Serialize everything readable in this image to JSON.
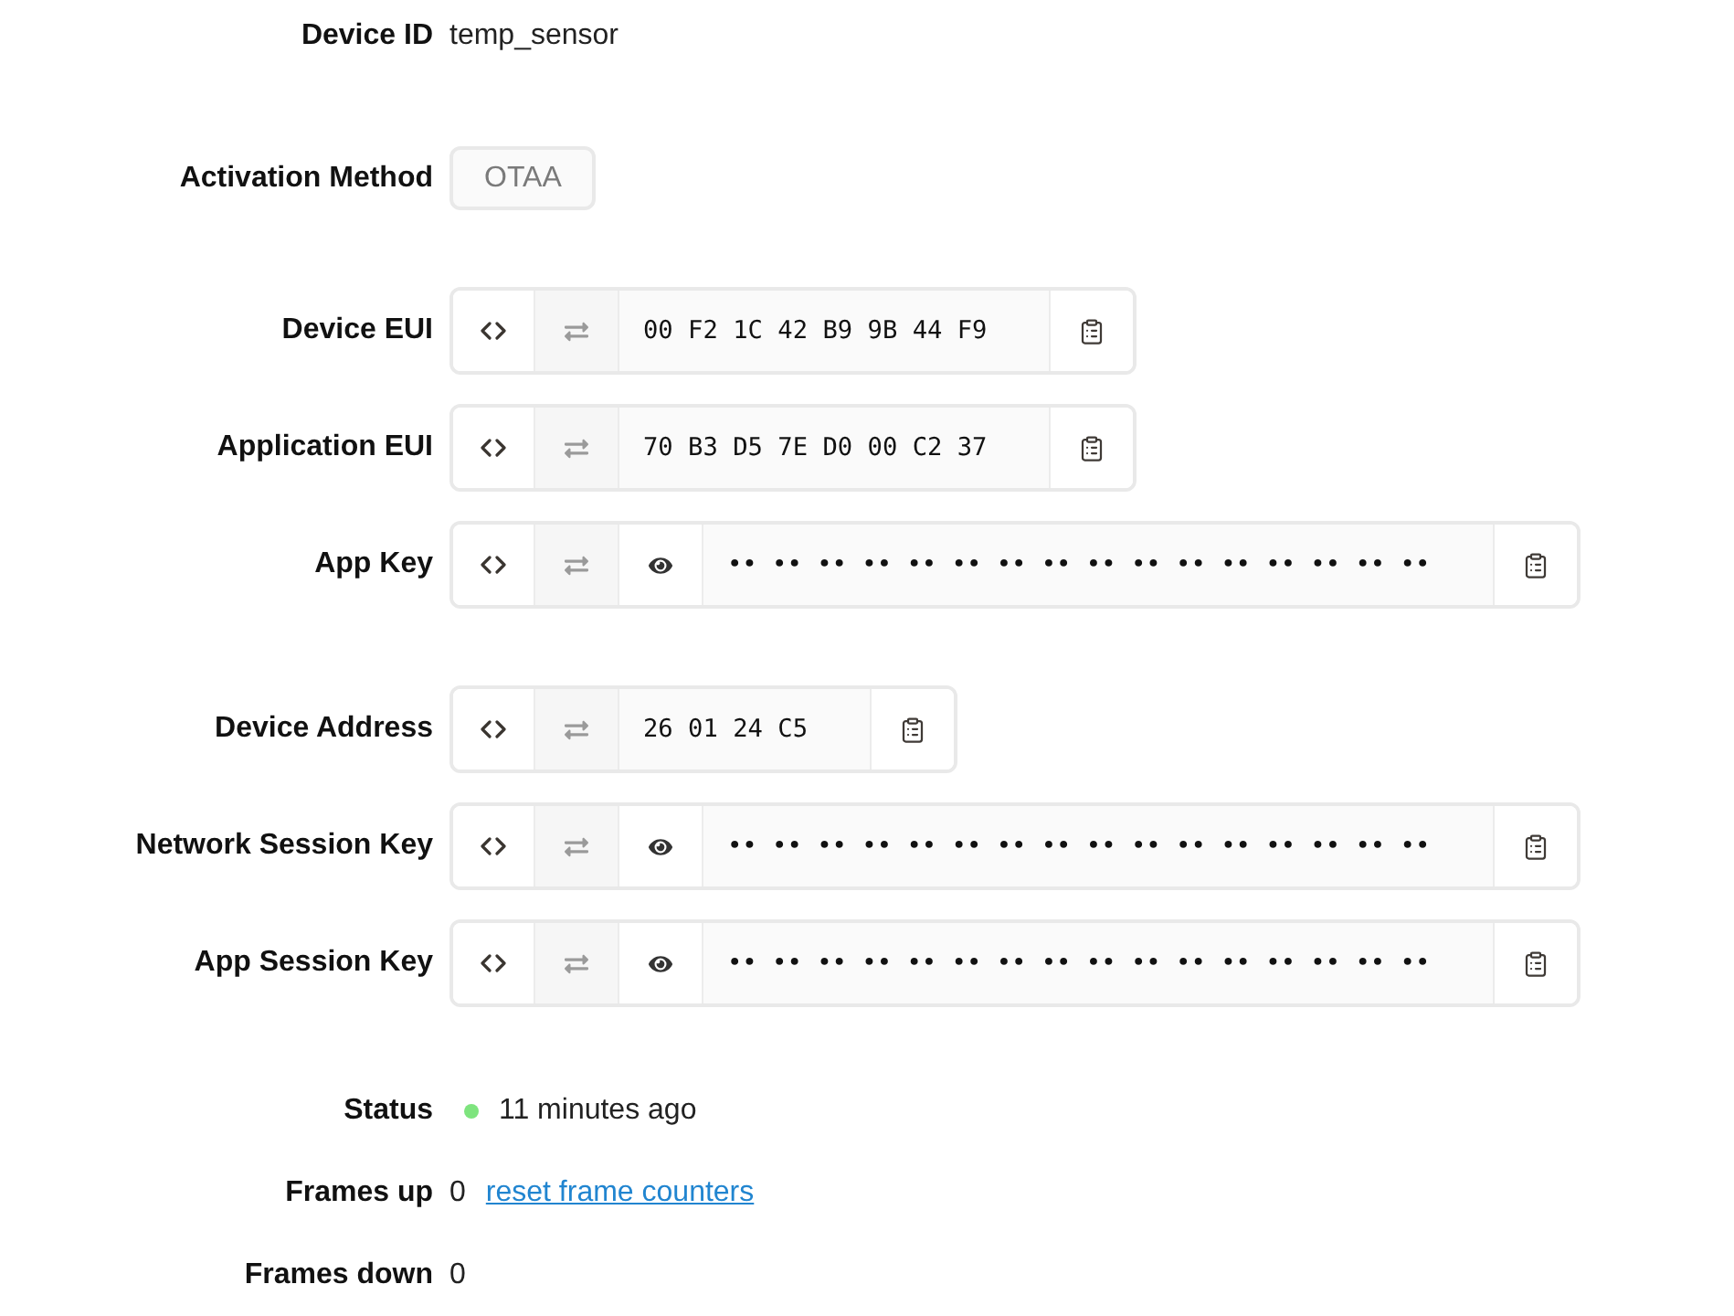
{
  "sections": [
    {
      "fields": [
        {
          "kind": "text",
          "label": "Device ID",
          "value": "temp_sensor"
        }
      ]
    },
    {
      "fields": [
        {
          "kind": "select",
          "label": "Activation Method",
          "value": "OTAA"
        }
      ]
    },
    {
      "fields": [
        {
          "kind": "hex",
          "label": "Device EUI",
          "value": "00 F2 1C 42 B9 9B 44 F9",
          "secret": false
        },
        {
          "kind": "hex",
          "label": "Application EUI",
          "value": "70 B3 D5 7E D0 00 C2 37",
          "secret": false
        },
        {
          "kind": "hex",
          "label": "App Key",
          "value": "•• •• •• •• •• •• •• •• •• •• •• •• •• •• •• ••",
          "secret": true
        }
      ]
    },
    {
      "fields": [
        {
          "kind": "hex",
          "label": "Device Address",
          "value": "26 01 24 C5",
          "secret": false
        },
        {
          "kind": "hex",
          "label": "Network Session Key",
          "value": "•• •• •• •• •• •• •• •• •• •• •• •• •• •• •• ••",
          "secret": true
        },
        {
          "kind": "hex",
          "label": "App Session Key",
          "value": "•• •• •• •• •• •• •• •• •• •• •• •• •• •• •• ••",
          "secret": true
        }
      ]
    },
    {
      "fields": [
        {
          "kind": "status",
          "label": "Status",
          "value": "11 minutes ago",
          "color": "#7ee47e"
        },
        {
          "kind": "counter",
          "label": "Frames up",
          "value": "0",
          "link": "reset frame counters"
        },
        {
          "kind": "counter",
          "label": "Frames down",
          "value": "0"
        }
      ]
    }
  ]
}
